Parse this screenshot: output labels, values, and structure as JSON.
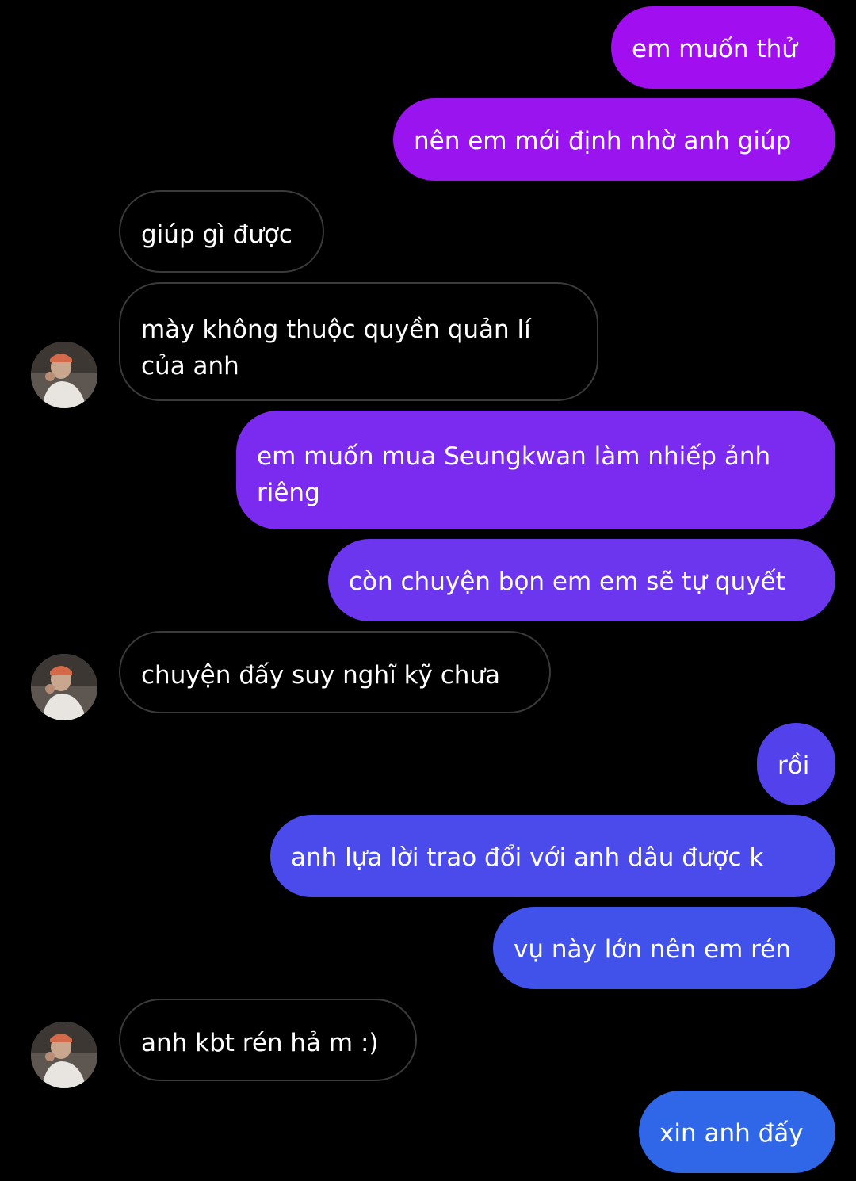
{
  "conversation": {
    "messages": [
      {
        "side": "out",
        "text": "em muốn thử"
      },
      {
        "side": "out",
        "text": "nên em mới định nhờ anh giúp"
      },
      {
        "side": "in",
        "text": "giúp gì được"
      },
      {
        "side": "in",
        "text": "mày không thuộc quyền quản lí của anh"
      },
      {
        "side": "out",
        "text": "em muốn mua Seungkwan làm nhiếp ảnh riêng"
      },
      {
        "side": "out",
        "text": "còn chuyện bọn em em sẽ tự quyết"
      },
      {
        "side": "in",
        "text": "chuyện đấy suy nghĩ kỹ chưa"
      },
      {
        "side": "out",
        "text": "rồi"
      },
      {
        "side": "out",
        "text": "anh lựa lời trao đổi với anh dâu được k"
      },
      {
        "side": "out",
        "text": "vụ này lớn nên em rén"
      },
      {
        "side": "in",
        "text": "anh kbt rén hả m :)"
      },
      {
        "side": "out",
        "text": "xin anh đấy"
      }
    ]
  },
  "colors": {
    "background": "#000000",
    "outgoing_gradient_top": "#a20ff0",
    "outgoing_gradient_bottom": "#2f6ae8",
    "incoming_border": "#3a3a3a",
    "text": "#ffffff"
  },
  "avatar": {
    "icon": "user-avatar-photo"
  }
}
